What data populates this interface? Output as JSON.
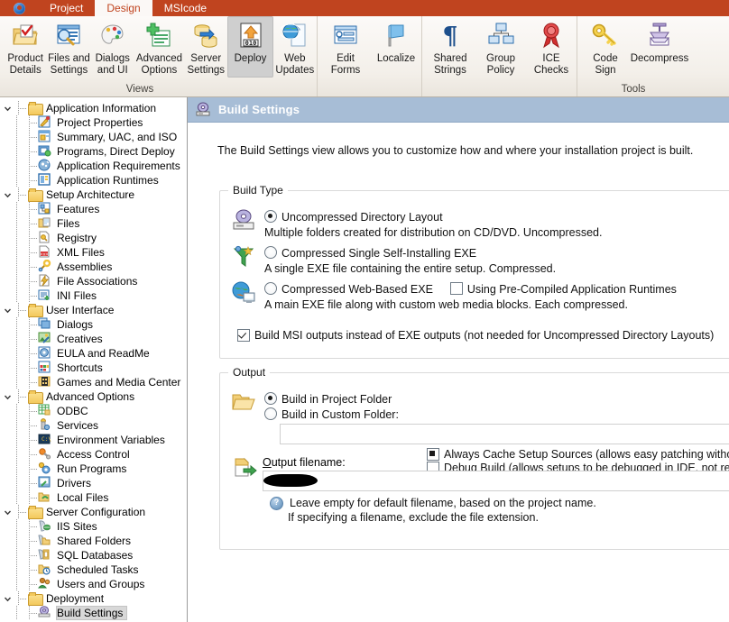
{
  "titlebar": {
    "orb_icon": "app-orb-icon",
    "tabs": [
      {
        "label": "Project",
        "active": false
      },
      {
        "label": "Design",
        "active": true
      },
      {
        "label": "MSIcode",
        "active": false
      }
    ]
  },
  "ribbon": {
    "groups": [
      {
        "label": "Views",
        "buttons": [
          {
            "label_line1": "Product",
            "label_line2": "Details",
            "icon": "product-details-icon",
            "selected": false
          },
          {
            "label_line1": "Files and",
            "label_line2": "Settings",
            "icon": "files-settings-icon",
            "selected": false
          },
          {
            "label_line1": "Dialogs",
            "label_line2": "and UI",
            "icon": "dialogs-ui-icon",
            "selected": false
          },
          {
            "label_line1": "Advanced",
            "label_line2": "Options",
            "icon": "advanced-options-icon",
            "selected": false
          },
          {
            "label_line1": "Server",
            "label_line2": "Settings",
            "icon": "server-settings-icon",
            "selected": false
          },
          {
            "label_line1": "Deploy",
            "label_line2": "",
            "icon": "deploy-icon",
            "selected": true
          },
          {
            "label_line1": "Web",
            "label_line2": "Updates",
            "icon": "web-updates-icon",
            "selected": false
          }
        ]
      },
      {
        "label": "",
        "buttons": [
          {
            "label_line1": "Edit",
            "label_line2": "Forms",
            "icon": "edit-forms-icon",
            "selected": false
          },
          {
            "label_line1": "Localize",
            "label_line2": "",
            "icon": "localize-icon",
            "selected": false
          }
        ]
      },
      {
        "label": "",
        "buttons": [
          {
            "label_line1": "Shared",
            "label_line2": "Strings",
            "icon": "shared-strings-icon",
            "selected": false
          },
          {
            "label_line1": "Group",
            "label_line2": "Policy",
            "icon": "group-policy-icon",
            "selected": false
          },
          {
            "label_line1": "ICE",
            "label_line2": "Checks",
            "icon": "ice-checks-icon",
            "selected": false
          }
        ]
      },
      {
        "label": "Tools",
        "buttons": [
          {
            "label_line1": "Code",
            "label_line2": "Sign",
            "icon": "code-sign-icon",
            "selected": false
          },
          {
            "label_line1": "Decompress",
            "label_line2": "",
            "icon": "decompress-icon",
            "selected": false
          }
        ]
      }
    ]
  },
  "sidebar": {
    "nodes": [
      {
        "label": "Application Information",
        "level": 0,
        "expanded": true,
        "icon": "folder-icon",
        "selected": false
      },
      {
        "label": "Project Properties",
        "level": 1,
        "expanded": null,
        "icon": "project-properties-icon",
        "selected": false
      },
      {
        "label": "Summary, UAC, and ISO",
        "level": 1,
        "expanded": null,
        "icon": "summary-uac-iso-icon",
        "selected": false
      },
      {
        "label": "Programs, Direct Deploy",
        "level": 1,
        "expanded": null,
        "icon": "programs-direct-deploy-icon",
        "selected": false
      },
      {
        "label": "Application Requirements",
        "level": 1,
        "expanded": null,
        "icon": "app-requirements-icon",
        "selected": false
      },
      {
        "label": "Application Runtimes",
        "level": 1,
        "expanded": null,
        "icon": "app-runtimes-icon",
        "selected": false
      },
      {
        "label": "Setup Architecture",
        "level": 0,
        "expanded": true,
        "icon": "folder-icon",
        "selected": false
      },
      {
        "label": "Features",
        "level": 1,
        "expanded": null,
        "icon": "features-icon",
        "selected": false
      },
      {
        "label": "Files",
        "level": 1,
        "expanded": null,
        "icon": "files-icon",
        "selected": false
      },
      {
        "label": "Registry",
        "level": 1,
        "expanded": null,
        "icon": "registry-icon",
        "selected": false
      },
      {
        "label": "XML Files",
        "level": 1,
        "expanded": null,
        "icon": "xml-files-icon",
        "selected": false
      },
      {
        "label": "Assemblies",
        "level": 1,
        "expanded": null,
        "icon": "assemblies-icon",
        "selected": false
      },
      {
        "label": "File Associations",
        "level": 1,
        "expanded": null,
        "icon": "file-associations-icon",
        "selected": false
      },
      {
        "label": "INI Files",
        "level": 1,
        "expanded": null,
        "icon": "ini-files-icon",
        "selected": false
      },
      {
        "label": "User Interface",
        "level": 0,
        "expanded": true,
        "icon": "folder-icon",
        "selected": false
      },
      {
        "label": "Dialogs",
        "level": 1,
        "expanded": null,
        "icon": "dialogs-icon",
        "selected": false
      },
      {
        "label": "Creatives",
        "level": 1,
        "expanded": null,
        "icon": "creatives-icon",
        "selected": false
      },
      {
        "label": "EULA and ReadMe",
        "level": 1,
        "expanded": null,
        "icon": "eula-readme-icon",
        "selected": false
      },
      {
        "label": "Shortcuts",
        "level": 1,
        "expanded": null,
        "icon": "shortcuts-icon",
        "selected": false
      },
      {
        "label": "Games and Media Center",
        "level": 1,
        "expanded": null,
        "icon": "games-media-center-icon",
        "selected": false
      },
      {
        "label": "Advanced Options",
        "level": 0,
        "expanded": true,
        "icon": "folder-icon",
        "selected": false
      },
      {
        "label": "ODBC",
        "level": 1,
        "expanded": null,
        "icon": "odbc-icon",
        "selected": false
      },
      {
        "label": "Services",
        "level": 1,
        "expanded": null,
        "icon": "services-icon",
        "selected": false
      },
      {
        "label": "Environment Variables",
        "level": 1,
        "expanded": null,
        "icon": "environment-variables-icon",
        "selected": false
      },
      {
        "label": "Access Control",
        "level": 1,
        "expanded": null,
        "icon": "access-control-icon",
        "selected": false
      },
      {
        "label": "Run Programs",
        "level": 1,
        "expanded": null,
        "icon": "run-programs-icon",
        "selected": false
      },
      {
        "label": "Drivers",
        "level": 1,
        "expanded": null,
        "icon": "drivers-icon",
        "selected": false
      },
      {
        "label": "Local Files",
        "level": 1,
        "expanded": null,
        "icon": "local-files-icon",
        "selected": false
      },
      {
        "label": "Server Configuration",
        "level": 0,
        "expanded": true,
        "icon": "folder-icon",
        "selected": false
      },
      {
        "label": "IIS Sites",
        "level": 1,
        "expanded": null,
        "icon": "iis-sites-icon",
        "selected": false
      },
      {
        "label": "Shared Folders",
        "level": 1,
        "expanded": null,
        "icon": "shared-folders-icon",
        "selected": false
      },
      {
        "label": "SQL Databases",
        "level": 1,
        "expanded": null,
        "icon": "sql-databases-icon",
        "selected": false
      },
      {
        "label": "Scheduled Tasks",
        "level": 1,
        "expanded": null,
        "icon": "scheduled-tasks-icon",
        "selected": false
      },
      {
        "label": "Users and Groups",
        "level": 1,
        "expanded": null,
        "icon": "users-groups-icon",
        "selected": false
      },
      {
        "label": "Deployment",
        "level": 0,
        "expanded": true,
        "icon": "folder-icon",
        "selected": false
      },
      {
        "label": "Build Settings",
        "level": 1,
        "expanded": null,
        "icon": "build-settings-icon",
        "selected": true
      }
    ]
  },
  "pane": {
    "icon": "build-settings-icon",
    "title": "Build Settings",
    "intro": "The Build Settings view allows you to customize how and where your installation project is built."
  },
  "build_type": {
    "legend": "Build Type",
    "options": [
      {
        "title": "Uncompressed Directory Layout",
        "desc": "Multiple folders created for distribution on CD/DVD. Uncompressed.",
        "selected": true,
        "icon": "cd-dvd-layout-icon"
      },
      {
        "title": "Compressed Single Self-Installing EXE",
        "desc": "A single EXE file containing the entire setup. Compressed.",
        "selected": false,
        "icon": "funnel-exe-icon"
      },
      {
        "title": "Compressed Web-Based EXE",
        "desc": "A main EXE file along with custom web media blocks. Each compressed.",
        "selected": false,
        "icon": "web-exe-icon",
        "inline_checkbox": {
          "label": "Using Pre-Compiled Application Runtimes",
          "state": "unchecked"
        }
      }
    ],
    "flags": [
      {
        "label": "Build MSI outputs instead of EXE outputs (not needed for Uncompressed Directory Layouts)",
        "state": "checked"
      },
      {
        "label": "Always Cache Setup Sources (allows easy patching without requiring access to original setup sources)",
        "state": "mixed"
      },
      {
        "label": "Debug Build (allows setups to be debugged in IDE, not required with Uncompressed Directory Layouts)",
        "state": "unchecked"
      }
    ]
  },
  "output": {
    "legend": "Output",
    "folder_icon": "open-folder-icon",
    "options": [
      {
        "label": "Build in Project Folder",
        "selected": true
      },
      {
        "label": "Build in Custom Folder:",
        "selected": false
      }
    ],
    "custom_folder_value": "",
    "custom_folder_placeholder": "",
    "filename_icon": "export-file-icon",
    "filename_label": "Output filename:",
    "filename_accesskey": "O",
    "filename_value": "",
    "filename_redacted": true,
    "hints": [
      "Leave empty for default filename, based on the project name.",
      "If specifying a filename, exclude the file extension."
    ],
    "hint_icon": "help-info-icon"
  }
}
